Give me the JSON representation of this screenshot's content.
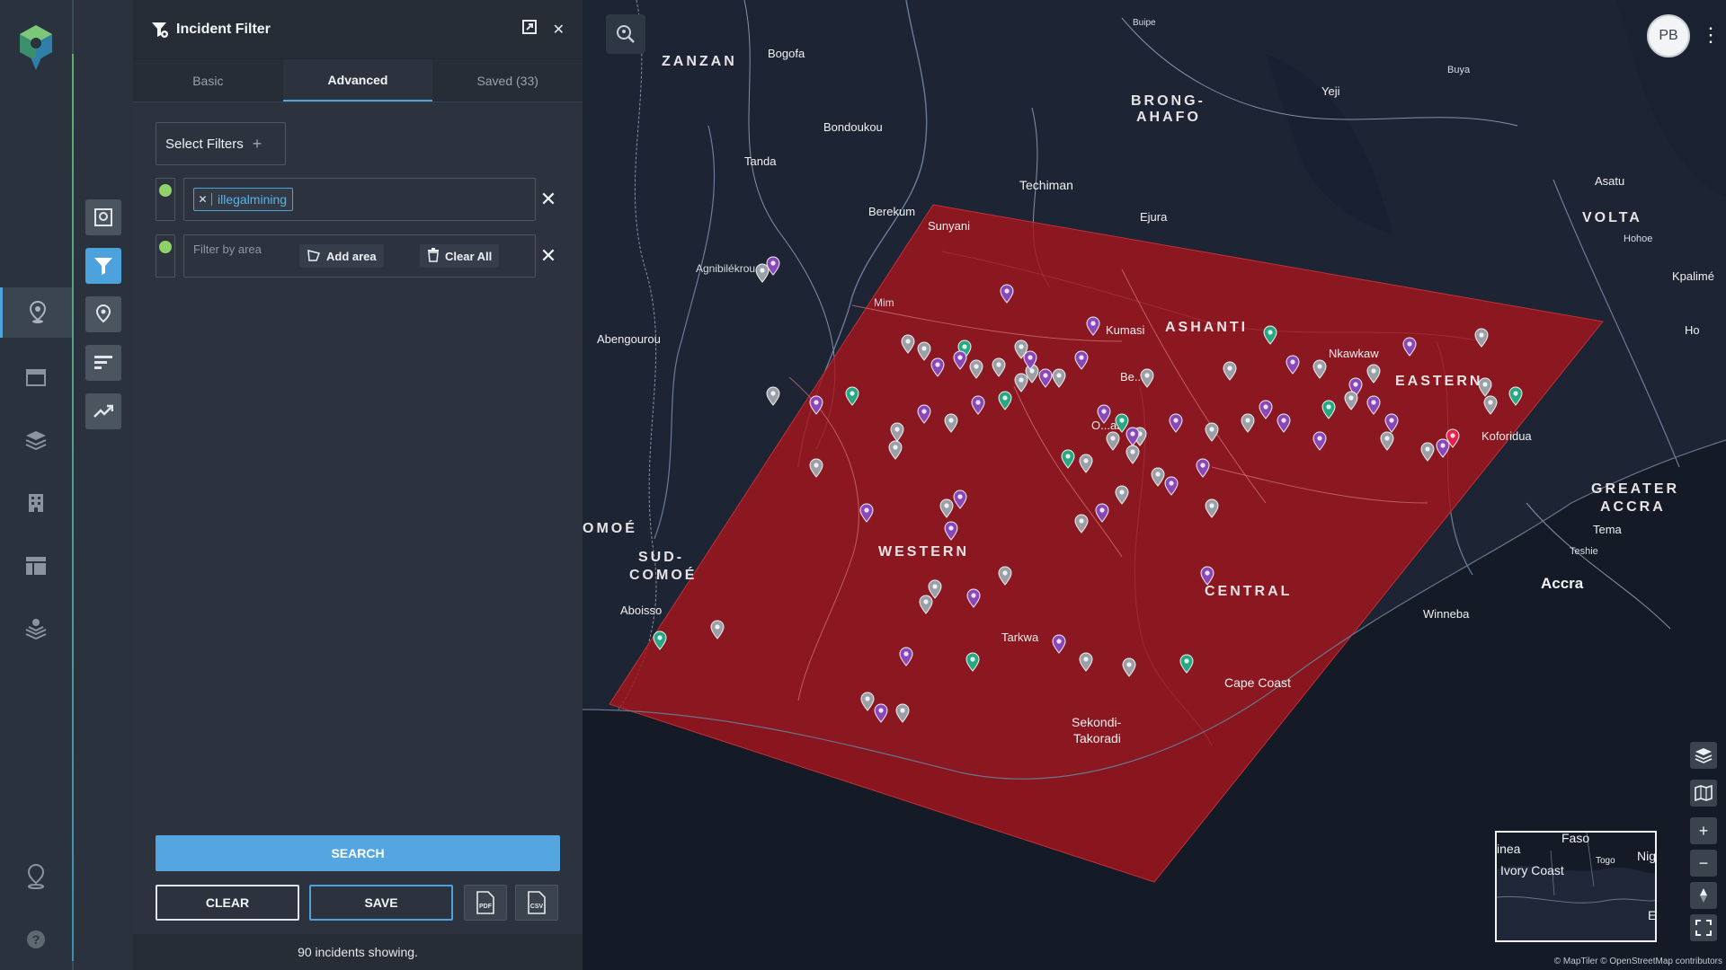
{
  "panel": {
    "title": "Incident Filter",
    "tabs": [
      "Basic",
      "Advanced",
      "Saved (33)"
    ],
    "active_tab": "Advanced",
    "select_filters_label": "Select Filters",
    "filters": {
      "tag_chip": "illegalmining",
      "area_placeholder": "Filter by area",
      "add_area_label": "Add area",
      "clear_all_label": "Clear All"
    },
    "search_label": "SEARCH",
    "clear_label": "CLEAR",
    "save_label": "SAVE",
    "pdf_label": "PDF",
    "csv_label": "CSV",
    "count_text": "90 incidents showing."
  },
  "map": {
    "user_initials": "PB",
    "attribution": "© MapTiler © OpenStreetMap contributors",
    "region_labels": [
      "ZANZAN",
      "BRONG-AHAFO",
      "ASHANTI",
      "EASTERN",
      "WESTERN",
      "CENTRAL",
      "VOLTA",
      "GREATER ACCRA",
      "SUD-COMOÉ",
      "OMOÉ"
    ],
    "labels": {
      "zanzan": "ZANZAN",
      "brong": "BRONG-",
      "ahafo": "AHAFO",
      "ashanti": "ASHANTI",
      "eastern": "EASTERN",
      "western": "WESTERN",
      "central": "CENTRAL",
      "volta": "VOLTA",
      "greater": "GREATER",
      "accra_r": "ACCRA",
      "sud": "SUD-",
      "comoe": "COMOÉ",
      "omoe": "OMOÉ",
      "bogofa": "Bogofa",
      "buipe": "Buipe",
      "buya": "Buya",
      "yeji": "Yeji",
      "bondoukou": "Bondoukou",
      "tanda": "Tanda",
      "techiman": "Techiman",
      "berekum": "Berekum",
      "ejura": "Ejura",
      "asatu": "Asatu",
      "hohoe": "Hohoe",
      "kpalime": "Kpalimé",
      "ho": "Ho",
      "sunyani": "Sunyani",
      "agnibilekrou": "Agnibilékrou",
      "mim": "Mim",
      "kumasi": "Kumasi",
      "abengourou": "Abengourou",
      "nkawkaw": "Nkawkaw",
      "koforidua": "Koforidua",
      "bekwai": "Be...",
      "obuasi": "O...asi",
      "tema": "Tema",
      "teshie": "Teshie",
      "accra": "Accra",
      "winneba": "Winneba",
      "capecoast": "Cape Coast",
      "sekondi": "Sekondi-",
      "takoradi": "Takoradi",
      "tarkwa": "Tarkwa",
      "aboisso": "Aboisso"
    },
    "minimap": {
      "faso": "Faso",
      "inea": "inea",
      "niger": "Nig",
      "ivory": "Ivory Coast",
      "togo": "Togo",
      "e": "E"
    }
  },
  "colors": {
    "accent": "#4ba2dc",
    "polygon": "#a3151d",
    "pin_purple": "#8a47b8",
    "pin_grey": "#9aa0a6",
    "pin_green": "#27a882",
    "pin_red": "#e5224b",
    "active_dot": "#8fd16a"
  },
  "icons": [
    "logo-icon",
    "map-pin-icon",
    "calendar-icon",
    "layers-icon",
    "building-icon",
    "table-icon",
    "stack-pin-icon",
    "location-icon",
    "help-icon",
    "filter-icon",
    "expand-icon",
    "close-icon",
    "search-map-icon",
    "zoom-in-icon",
    "zoom-out-icon",
    "compass-icon",
    "fullscreen-icon"
  ]
}
